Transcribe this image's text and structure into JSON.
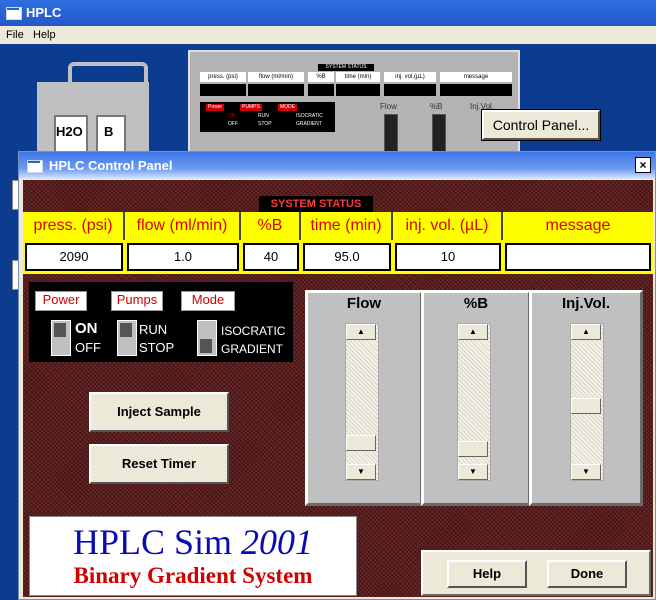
{
  "main_window": {
    "title": "HPLC",
    "menu": [
      "File",
      "Help"
    ]
  },
  "background_panel": {
    "system_status_label": "SYSTEM STATUS",
    "headers": [
      "press. (psi)",
      "flow (ml/min)",
      "%B",
      "time (min)",
      "inj. vol.(µL)",
      "message"
    ],
    "tags": [
      "Power",
      "PUMPS",
      "MODE"
    ],
    "switches": [
      [
        "ON",
        "OFF"
      ],
      [
        "RUN",
        "STOP"
      ],
      [
        "ISOCRATIC",
        "GRADIENT"
      ]
    ],
    "slider_labels": [
      "Flow",
      "%B",
      "Inj.Vol."
    ],
    "bottles": [
      "H2O",
      "B"
    ],
    "control_panel_button": "Control Panel..."
  },
  "dialog": {
    "title": "HPLC Control Panel",
    "close": "×",
    "system_status": "SYSTEM STATUS",
    "columns": [
      {
        "header": "press. (psi)",
        "value": "2090"
      },
      {
        "header": "flow (ml/min)",
        "value": "1.0"
      },
      {
        "header": "%B",
        "value": "40"
      },
      {
        "header": "time (min)",
        "value": "95.0"
      },
      {
        "header": "inj. vol. (µL)",
        "value": "10"
      },
      {
        "header": "message",
        "value": ""
      }
    ],
    "power": {
      "label": "Power",
      "on": "ON",
      "off": "OFF"
    },
    "pumps": {
      "label": "Pumps",
      "run": "RUN",
      "stop": "STOP"
    },
    "mode": {
      "label": "Mode",
      "isocratic": "ISOCRATIC",
      "gradient": "GRADIENT"
    },
    "inject_button": "Inject Sample",
    "reset_button": "Reset Timer",
    "sliders": [
      {
        "label": "Flow",
        "level": 0.1
      },
      {
        "label": "%B",
        "level": 0.05
      },
      {
        "label": "Inj.Vol.",
        "level": 0.45
      }
    ],
    "logo": {
      "line1_a": "HPLC Sim ",
      "line1_b": "2001",
      "line2": "Binary Gradient System"
    },
    "help_button": "Help",
    "done_button": "Done"
  }
}
